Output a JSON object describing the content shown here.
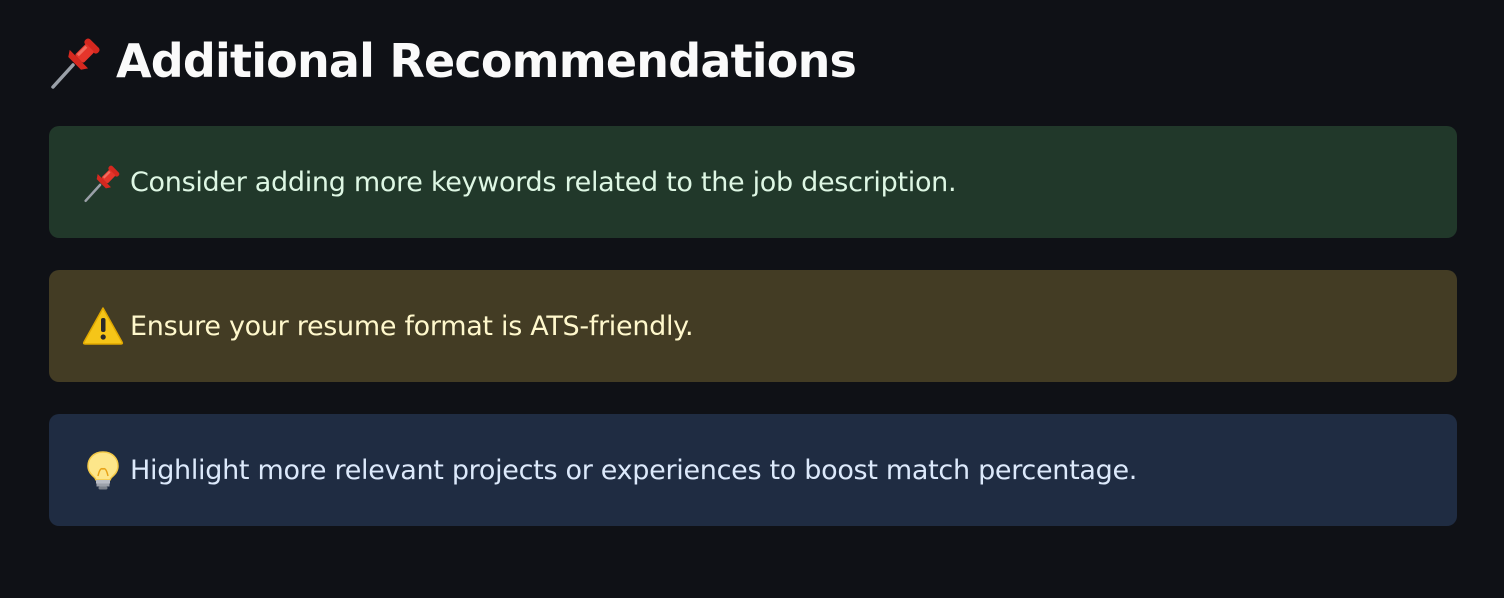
{
  "heading": {
    "icon": "pushpin-icon",
    "text": "Additional Recommendations"
  },
  "alerts": [
    {
      "type": "success",
      "icon": "pushpin-icon",
      "text": "Consider adding more keywords related to the job description.",
      "background": "#21382a",
      "text_color": "#def7e4"
    },
    {
      "type": "warning",
      "icon": "warning-icon",
      "text": "Ensure your resume format is ATS-friendly.",
      "background": "#433c24",
      "text_color": "#fff8cc"
    },
    {
      "type": "info",
      "icon": "lightbulb-icon",
      "text": "Highlight more relevant projects or experiences to boost match percentage.",
      "background": "#1f2c42",
      "text_color": "#dce9fb"
    }
  ],
  "colors": {
    "page_background": "#0f1116",
    "heading_text": "#fafafa"
  }
}
